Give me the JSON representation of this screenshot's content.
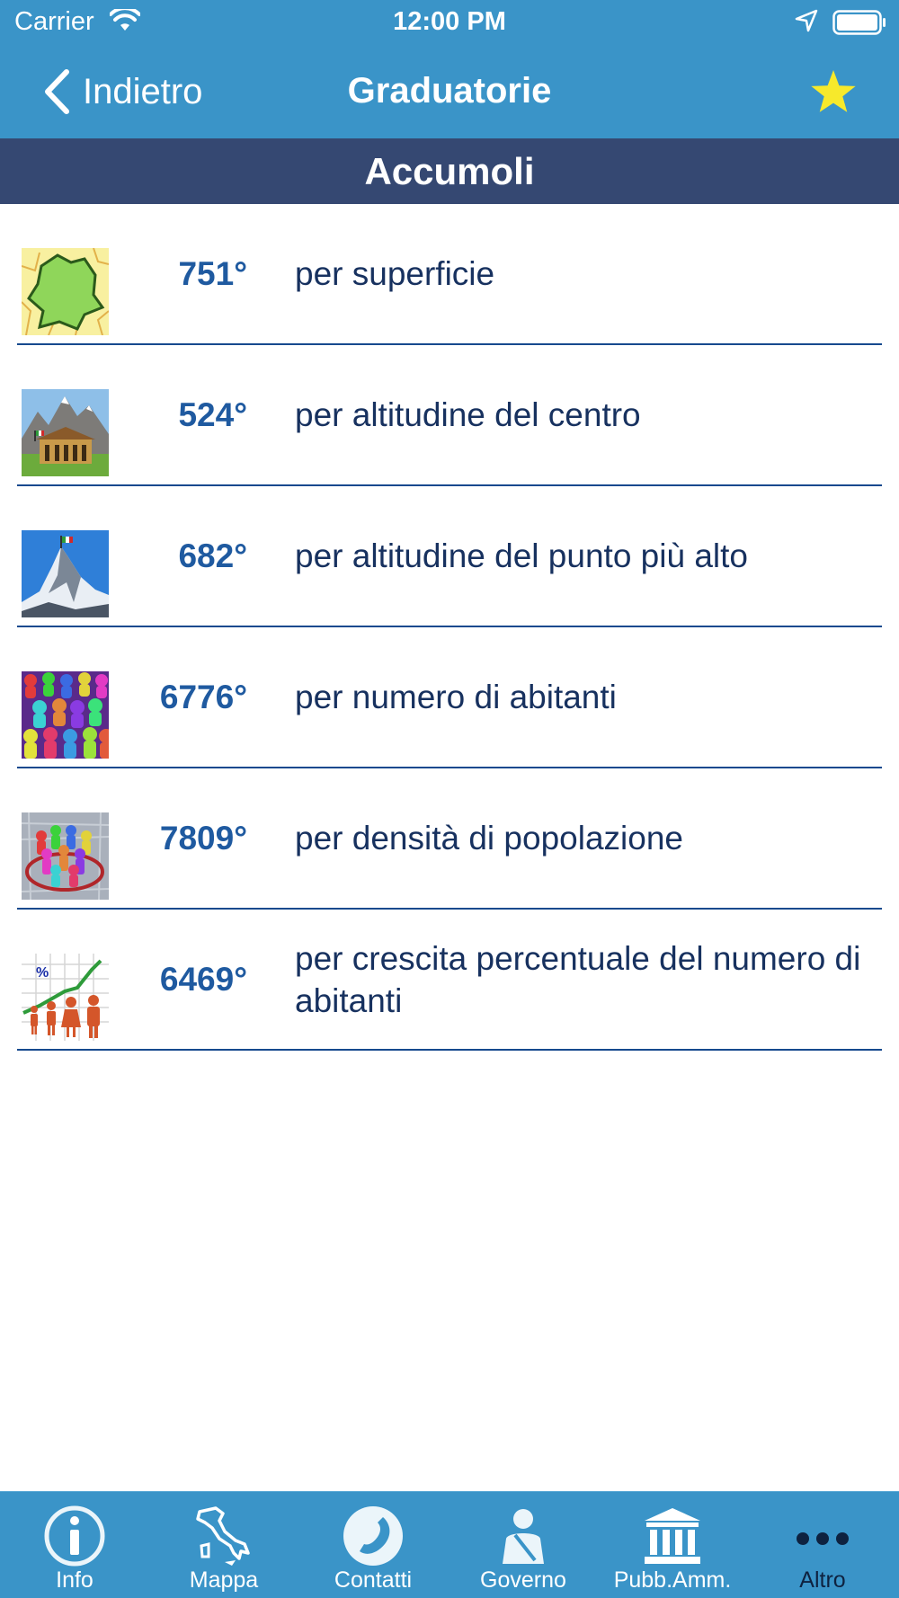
{
  "status": {
    "carrier": "Carrier",
    "time": "12:00 PM"
  },
  "nav": {
    "back_label": "Indietro",
    "title": "Graduatorie"
  },
  "banner": {
    "municipality": "Accumoli"
  },
  "rankings": [
    {
      "rank": "751°",
      "label": "per superficie",
      "icon": "area-map-icon"
    },
    {
      "rank": "524°",
      "label": "per altitudine del centro",
      "icon": "town-hall-mountain-icon"
    },
    {
      "rank": "682°",
      "label": "per altitudine del punto più alto",
      "icon": "mountain-peak-icon"
    },
    {
      "rank": "6776°",
      "label": "per numero di abitanti",
      "icon": "crowd-icon"
    },
    {
      "rank": "7809°",
      "label": "per densità di popolazione",
      "icon": "population-density-icon"
    },
    {
      "rank": "6469°",
      "label": "per crescita percentuale del numero di abitanti",
      "icon": "growth-chart-icon"
    }
  ],
  "tabs": [
    {
      "label": "Info",
      "icon": "info-icon"
    },
    {
      "label": "Mappa",
      "icon": "italy-map-icon"
    },
    {
      "label": "Contatti",
      "icon": "phone-icon"
    },
    {
      "label": "Governo",
      "icon": "mayor-icon"
    },
    {
      "label": "Pubb.Amm.",
      "icon": "building-icon"
    },
    {
      "label": "Altro",
      "icon": "more-icon"
    }
  ],
  "colors": {
    "header": "#3a94c8",
    "banner": "#354872",
    "rank_text": "#1f5aa0",
    "separator": "#16498e",
    "star": "#f7e92b",
    "active_tab": "#0e2240"
  }
}
